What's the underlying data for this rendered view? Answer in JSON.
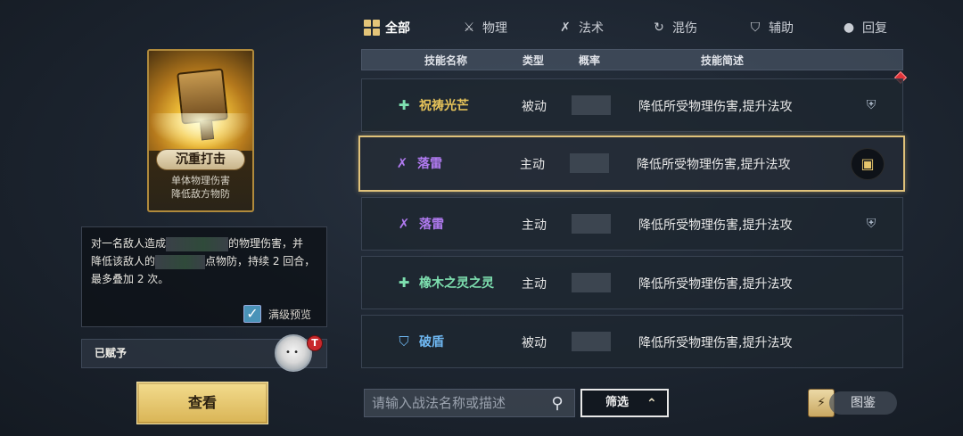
{
  "card": {
    "name": "沉重打击",
    "desc_line1": "单体物理伤害",
    "desc_line2": "降低敌方物防"
  },
  "description": {
    "part1": "对一名敌人造成",
    "part2": "的物理伤害，并",
    "part3": "降低该敌人的",
    "part4": "点物防，持续 2 回合，",
    "part5": "最多叠加 2 次。"
  },
  "preview": {
    "label": "满级预览",
    "checked": true
  },
  "assigned": {
    "label": "已赋予"
  },
  "view_button": "查看",
  "tabs": [
    {
      "label": "全部",
      "icon": "grid-icon",
      "active": true
    },
    {
      "label": "物理",
      "icon": "sword-icon",
      "active": false
    },
    {
      "label": "法术",
      "icon": "magic-icon",
      "active": false
    },
    {
      "label": "混伤",
      "icon": "swirl-icon",
      "active": false
    },
    {
      "label": "辅助",
      "icon": "shield-icon",
      "active": false
    },
    {
      "label": "回复",
      "icon": "drop-icon",
      "active": false
    }
  ],
  "table": {
    "headers": [
      "技能名称",
      "类型",
      "概率",
      "技能简述"
    ],
    "rows": [
      {
        "name": "祝祷光芒",
        "type": "被动",
        "desc": "降低所受物理伤害,提升法攻",
        "icon": "heal-drop-icon",
        "color": "#e7c45a",
        "badge": "helmet-icon"
      },
      {
        "name": "落雷",
        "type": "主动",
        "desc": "降低所受物理伤害,提升法攻",
        "icon": "magic-icon",
        "color": "#b07af0",
        "badge": "card-icon"
      },
      {
        "name": "落雷",
        "type": "主动",
        "desc": "降低所受物理伤害,提升法攻",
        "icon": "magic-icon",
        "color": "#b07af0",
        "badge": "helmet-icon"
      },
      {
        "name": "橡木之灵之灵",
        "type": "主动",
        "desc": "降低所受物理伤害,提升法攻",
        "icon": "heal-drop-icon",
        "color": "#7ee0b0",
        "badge": ""
      },
      {
        "name": "破盾",
        "type": "被动",
        "desc": "降低所受物理伤害,提升法攻",
        "icon": "shield-icon",
        "color": "#6fb8f2",
        "badge": ""
      }
    ]
  },
  "search": {
    "placeholder": "请输入战法名称或描述"
  },
  "filter_label": "筛选",
  "atlas_label": "图鉴"
}
